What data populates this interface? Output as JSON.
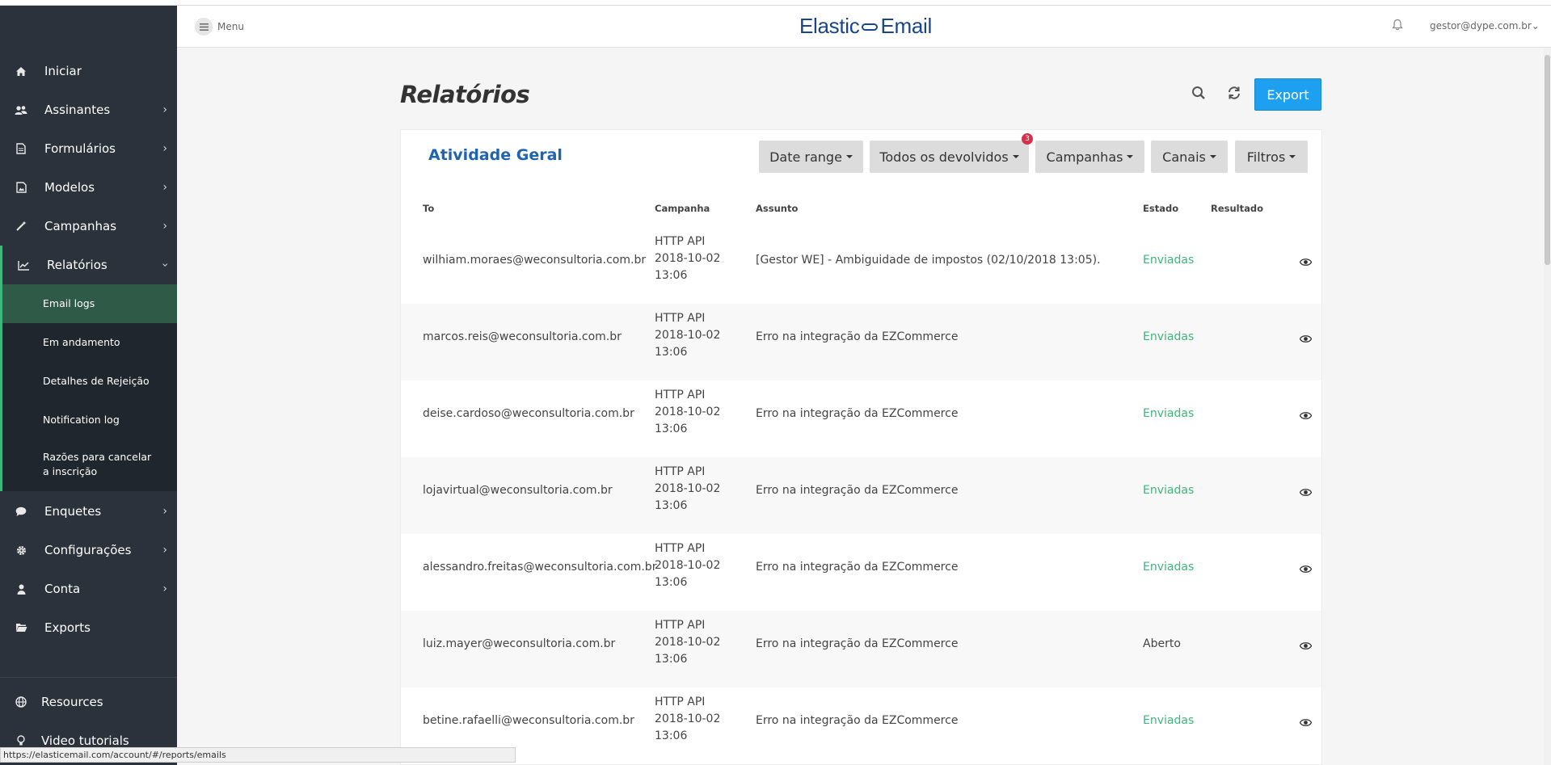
{
  "header": {
    "menu_label": "Menu",
    "logo_left": "Elastic",
    "logo_right": "Email",
    "user": "gestor@dype.com.br",
    "brand_color": "#17458f"
  },
  "sidebar": {
    "items": [
      {
        "label": "Iniciar",
        "icon": "home-icon"
      },
      {
        "label": "Assinantes",
        "icon": "users-icon"
      },
      {
        "label": "Formulários",
        "icon": "form-icon"
      },
      {
        "label": "Modelos",
        "icon": "image-icon"
      },
      {
        "label": "Campanhas",
        "icon": "wand-icon"
      },
      {
        "label": "Relatórios",
        "icon": "chart-icon"
      }
    ],
    "subitems": [
      {
        "label": "Email logs"
      },
      {
        "label": "Em andamento"
      },
      {
        "label": "Detalhes de Rejeição"
      },
      {
        "label": "Notification log"
      },
      {
        "label": "Razões para cancelar a inscrição"
      }
    ],
    "items_after": [
      {
        "label": "Enquetes",
        "icon": "chat-icon"
      },
      {
        "label": "Configurações",
        "icon": "gear-icon"
      },
      {
        "label": "Conta",
        "icon": "user-icon"
      },
      {
        "label": "Exports",
        "icon": "folder-icon"
      }
    ],
    "footer": [
      {
        "label": "Resources",
        "icon": "globe-icon"
      },
      {
        "label": "Video tutorials",
        "icon": "bulb-icon"
      }
    ],
    "accent_color": "#3fb67b"
  },
  "page": {
    "title": "Relatórios",
    "export_label": "Export"
  },
  "card": {
    "title": "Atividade Geral",
    "filters": [
      "Date range",
      "Todos os devolvidos",
      "Campanhas",
      "Canais",
      "Filtros"
    ],
    "badge_count": "3"
  },
  "table": {
    "headers": [
      "To",
      "Campanha",
      "Assunto",
      "Estado",
      "Resultado"
    ],
    "rows": [
      {
        "to": "wilhiam.moraes@weconsultoria.com.br",
        "campaign": "HTTP API",
        "date": "2018-10-02",
        "time": "13:06",
        "subject": "[Gestor WE] - Ambiguidade de impostos (02/10/2018 13:05).",
        "status": "Enviadas"
      },
      {
        "to": "marcos.reis@weconsultoria.com.br",
        "campaign": "HTTP API",
        "date": "2018-10-02",
        "time": "13:06",
        "subject": "Erro na integração da EZCommerce",
        "status": "Enviadas"
      },
      {
        "to": "deise.cardoso@weconsultoria.com.br",
        "campaign": "HTTP API",
        "date": "2018-10-02",
        "time": "13:06",
        "subject": "Erro na integração da EZCommerce",
        "status": "Enviadas"
      },
      {
        "to": "lojavirtual@weconsultoria.com.br",
        "campaign": "HTTP API",
        "date": "2018-10-02",
        "time": "13:06",
        "subject": "Erro na integração da EZCommerce",
        "status": "Enviadas"
      },
      {
        "to": "alessandro.freitas@weconsultoria.com.br",
        "campaign": "HTTP API",
        "date": "2018-10-02",
        "time": "13:06",
        "subject": "Erro na integração da EZCommerce",
        "status": "Enviadas"
      },
      {
        "to": "luiz.mayer@weconsultoria.com.br",
        "campaign": "HTTP API",
        "date": "2018-10-02",
        "time": "13:06",
        "subject": "Erro na integração da EZCommerce",
        "status": "Aberto"
      },
      {
        "to": "betine.rafaelli@weconsultoria.com.br",
        "campaign": "HTTP API",
        "date": "2018-10-02",
        "time": "13:06",
        "subject": "Erro na integração da EZCommerce",
        "status": "Enviadas"
      }
    ],
    "sent_color": "#3bb77a"
  },
  "statusbar": {
    "url": "https://elasticemail.com/account/#/reports/emails"
  }
}
